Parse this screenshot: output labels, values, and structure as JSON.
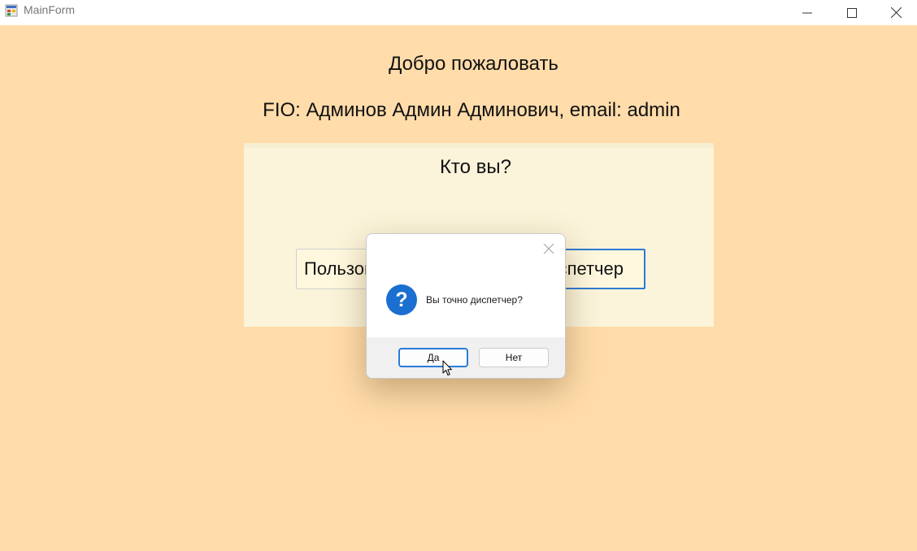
{
  "window": {
    "title": "MainForm",
    "controls": [
      "minimize-icon",
      "maximize-icon",
      "close-icon"
    ]
  },
  "main": {
    "welcome": "Добро пожаловать",
    "fio": "FIO: Админов Админ Админович, email: admin",
    "role_panel": {
      "title": "Кто вы?",
      "user_button": "Пользователь",
      "dispatcher_button": "Диспетчер"
    }
  },
  "dialog": {
    "icon": "question-icon",
    "icon_glyph": "?",
    "message": "Вы точно диспетчер?",
    "yes_label": "Да",
    "no_label": "Нет"
  },
  "colors": {
    "background": "#ffdcaa",
    "panel": "#fbf4da",
    "accent": "#1a6fd0"
  }
}
